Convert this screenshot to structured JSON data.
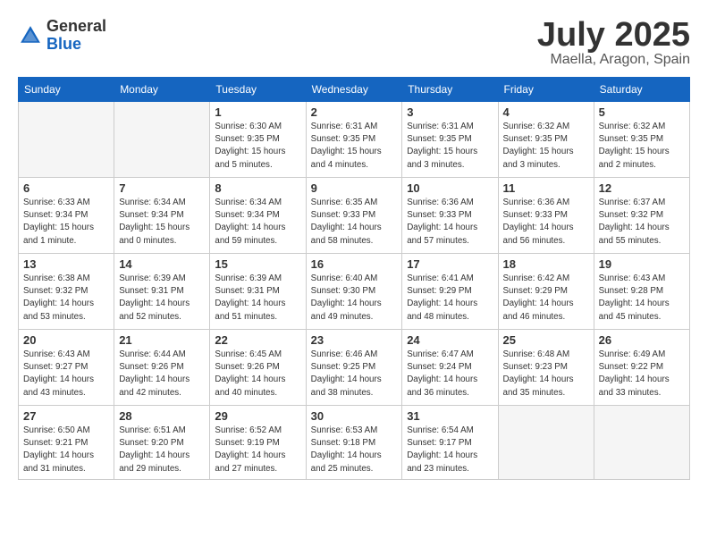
{
  "header": {
    "logo_general": "General",
    "logo_blue": "Blue",
    "month_title": "July 2025",
    "location": "Maella, Aragon, Spain"
  },
  "weekdays": [
    "Sunday",
    "Monday",
    "Tuesday",
    "Wednesday",
    "Thursday",
    "Friday",
    "Saturday"
  ],
  "weeks": [
    [
      {
        "day": "",
        "sunrise": "",
        "sunset": "",
        "daylight": ""
      },
      {
        "day": "",
        "sunrise": "",
        "sunset": "",
        "daylight": ""
      },
      {
        "day": "1",
        "sunrise": "Sunrise: 6:30 AM",
        "sunset": "Sunset: 9:35 PM",
        "daylight": "Daylight: 15 hours and 5 minutes."
      },
      {
        "day": "2",
        "sunrise": "Sunrise: 6:31 AM",
        "sunset": "Sunset: 9:35 PM",
        "daylight": "Daylight: 15 hours and 4 minutes."
      },
      {
        "day": "3",
        "sunrise": "Sunrise: 6:31 AM",
        "sunset": "Sunset: 9:35 PM",
        "daylight": "Daylight: 15 hours and 3 minutes."
      },
      {
        "day": "4",
        "sunrise": "Sunrise: 6:32 AM",
        "sunset": "Sunset: 9:35 PM",
        "daylight": "Daylight: 15 hours and 3 minutes."
      },
      {
        "day": "5",
        "sunrise": "Sunrise: 6:32 AM",
        "sunset": "Sunset: 9:35 PM",
        "daylight": "Daylight: 15 hours and 2 minutes."
      }
    ],
    [
      {
        "day": "6",
        "sunrise": "Sunrise: 6:33 AM",
        "sunset": "Sunset: 9:34 PM",
        "daylight": "Daylight: 15 hours and 1 minute."
      },
      {
        "day": "7",
        "sunrise": "Sunrise: 6:34 AM",
        "sunset": "Sunset: 9:34 PM",
        "daylight": "Daylight: 15 hours and 0 minutes."
      },
      {
        "day": "8",
        "sunrise": "Sunrise: 6:34 AM",
        "sunset": "Sunset: 9:34 PM",
        "daylight": "Daylight: 14 hours and 59 minutes."
      },
      {
        "day": "9",
        "sunrise": "Sunrise: 6:35 AM",
        "sunset": "Sunset: 9:33 PM",
        "daylight": "Daylight: 14 hours and 58 minutes."
      },
      {
        "day": "10",
        "sunrise": "Sunrise: 6:36 AM",
        "sunset": "Sunset: 9:33 PM",
        "daylight": "Daylight: 14 hours and 57 minutes."
      },
      {
        "day": "11",
        "sunrise": "Sunrise: 6:36 AM",
        "sunset": "Sunset: 9:33 PM",
        "daylight": "Daylight: 14 hours and 56 minutes."
      },
      {
        "day": "12",
        "sunrise": "Sunrise: 6:37 AM",
        "sunset": "Sunset: 9:32 PM",
        "daylight": "Daylight: 14 hours and 55 minutes."
      }
    ],
    [
      {
        "day": "13",
        "sunrise": "Sunrise: 6:38 AM",
        "sunset": "Sunset: 9:32 PM",
        "daylight": "Daylight: 14 hours and 53 minutes."
      },
      {
        "day": "14",
        "sunrise": "Sunrise: 6:39 AM",
        "sunset": "Sunset: 9:31 PM",
        "daylight": "Daylight: 14 hours and 52 minutes."
      },
      {
        "day": "15",
        "sunrise": "Sunrise: 6:39 AM",
        "sunset": "Sunset: 9:31 PM",
        "daylight": "Daylight: 14 hours and 51 minutes."
      },
      {
        "day": "16",
        "sunrise": "Sunrise: 6:40 AM",
        "sunset": "Sunset: 9:30 PM",
        "daylight": "Daylight: 14 hours and 49 minutes."
      },
      {
        "day": "17",
        "sunrise": "Sunrise: 6:41 AM",
        "sunset": "Sunset: 9:29 PM",
        "daylight": "Daylight: 14 hours and 48 minutes."
      },
      {
        "day": "18",
        "sunrise": "Sunrise: 6:42 AM",
        "sunset": "Sunset: 9:29 PM",
        "daylight": "Daylight: 14 hours and 46 minutes."
      },
      {
        "day": "19",
        "sunrise": "Sunrise: 6:43 AM",
        "sunset": "Sunset: 9:28 PM",
        "daylight": "Daylight: 14 hours and 45 minutes."
      }
    ],
    [
      {
        "day": "20",
        "sunrise": "Sunrise: 6:43 AM",
        "sunset": "Sunset: 9:27 PM",
        "daylight": "Daylight: 14 hours and 43 minutes."
      },
      {
        "day": "21",
        "sunrise": "Sunrise: 6:44 AM",
        "sunset": "Sunset: 9:26 PM",
        "daylight": "Daylight: 14 hours and 42 minutes."
      },
      {
        "day": "22",
        "sunrise": "Sunrise: 6:45 AM",
        "sunset": "Sunset: 9:26 PM",
        "daylight": "Daylight: 14 hours and 40 minutes."
      },
      {
        "day": "23",
        "sunrise": "Sunrise: 6:46 AM",
        "sunset": "Sunset: 9:25 PM",
        "daylight": "Daylight: 14 hours and 38 minutes."
      },
      {
        "day": "24",
        "sunrise": "Sunrise: 6:47 AM",
        "sunset": "Sunset: 9:24 PM",
        "daylight": "Daylight: 14 hours and 36 minutes."
      },
      {
        "day": "25",
        "sunrise": "Sunrise: 6:48 AM",
        "sunset": "Sunset: 9:23 PM",
        "daylight": "Daylight: 14 hours and 35 minutes."
      },
      {
        "day": "26",
        "sunrise": "Sunrise: 6:49 AM",
        "sunset": "Sunset: 9:22 PM",
        "daylight": "Daylight: 14 hours and 33 minutes."
      }
    ],
    [
      {
        "day": "27",
        "sunrise": "Sunrise: 6:50 AM",
        "sunset": "Sunset: 9:21 PM",
        "daylight": "Daylight: 14 hours and 31 minutes."
      },
      {
        "day": "28",
        "sunrise": "Sunrise: 6:51 AM",
        "sunset": "Sunset: 9:20 PM",
        "daylight": "Daylight: 14 hours and 29 minutes."
      },
      {
        "day": "29",
        "sunrise": "Sunrise: 6:52 AM",
        "sunset": "Sunset: 9:19 PM",
        "daylight": "Daylight: 14 hours and 27 minutes."
      },
      {
        "day": "30",
        "sunrise": "Sunrise: 6:53 AM",
        "sunset": "Sunset: 9:18 PM",
        "daylight": "Daylight: 14 hours and 25 minutes."
      },
      {
        "day": "31",
        "sunrise": "Sunrise: 6:54 AM",
        "sunset": "Sunset: 9:17 PM",
        "daylight": "Daylight: 14 hours and 23 minutes."
      },
      {
        "day": "",
        "sunrise": "",
        "sunset": "",
        "daylight": ""
      },
      {
        "day": "",
        "sunrise": "",
        "sunset": "",
        "daylight": ""
      }
    ]
  ]
}
